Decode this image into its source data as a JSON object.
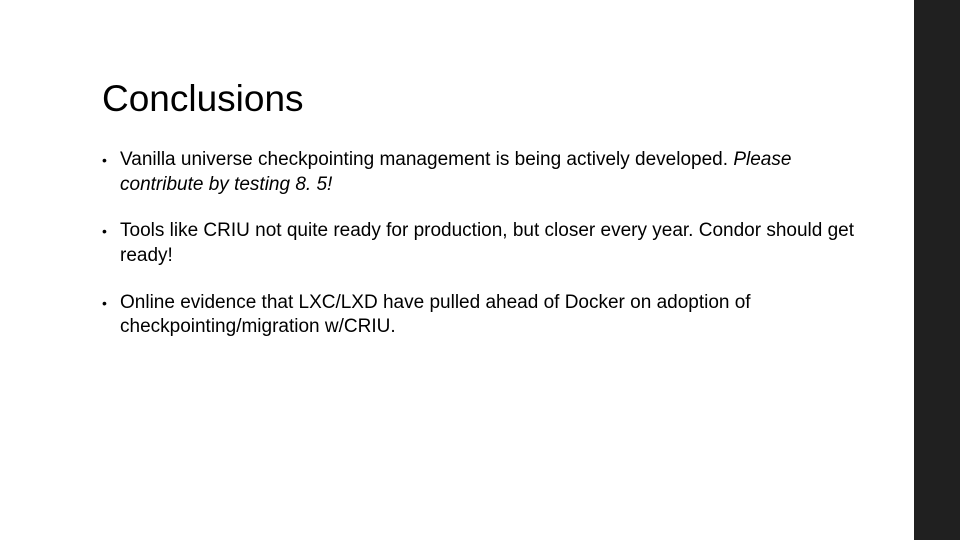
{
  "slide": {
    "title": "Conclusions",
    "bullets": [
      {
        "text_plain": "Vanilla universe checkpointing management is being actively developed. ",
        "text_italic": "Please contribute by testing 8. 5!"
      },
      {
        "text_plain": "Tools like CRIU not quite ready for production, but closer every year. Condor should get ready!",
        "text_italic": ""
      },
      {
        "text_plain": "Online evidence that LXC/LXD have pulled ahead of Docker on adoption of checkpointing/migration w/CRIU.",
        "text_italic": ""
      }
    ]
  }
}
